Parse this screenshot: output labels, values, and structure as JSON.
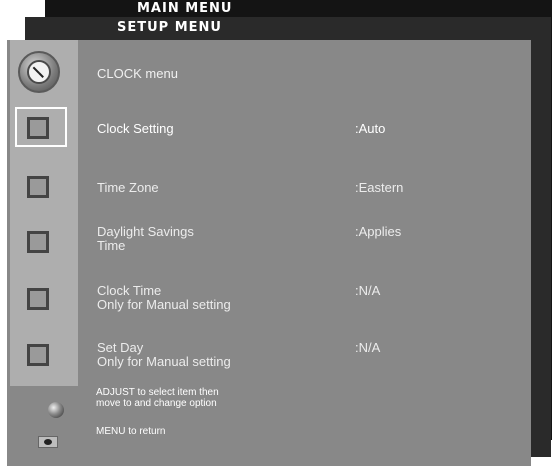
{
  "layers": {
    "main_menu_title": "MAIN MENU",
    "setup_menu_title": "SETUP MENU"
  },
  "panel": {
    "title": "CLOCK menu",
    "items": [
      {
        "label": "Clock Setting",
        "value": ":Auto",
        "selected": true
      },
      {
        "label": "Time Zone",
        "value": ":Eastern"
      },
      {
        "label": "Daylight Savings",
        "label2": "Time",
        "value": ":Applies"
      },
      {
        "label": "Clock Time",
        "label2": "Only for Manual setting",
        "value": ":N/A"
      },
      {
        "label": "Set Day",
        "label2": "Only for Manual setting",
        "value": ":N/A"
      }
    ]
  },
  "footer": {
    "adjust_line1": "ADJUST to select item then",
    "adjust_line2": "move to and change option",
    "menu_return": "MENU to return"
  },
  "icons": [
    "clock-icon",
    "selected-square-icon",
    "square-icon",
    "adjust-ball-icon",
    "remote-icon"
  ]
}
